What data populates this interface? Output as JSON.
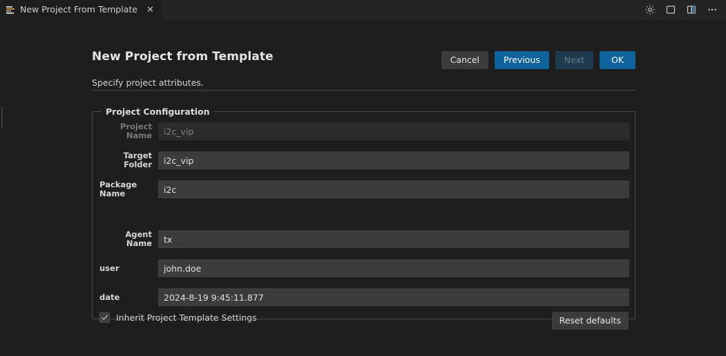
{
  "window": {
    "tab": {
      "icon": "list-lines-icon",
      "label": "New Project From Template",
      "close": "✕"
    },
    "actions": [
      {
        "name": "gear-icon",
        "tooltip": "Settings"
      },
      {
        "name": "single-pane-layout-icon",
        "tooltip": "Single Pane"
      },
      {
        "name": "split-pane-layout-icon",
        "tooltip": "Split Pane"
      },
      {
        "name": "more-options-icon",
        "tooltip": "More"
      }
    ]
  },
  "header": {
    "title": "New Project from Template",
    "subtitle": "Specify project attributes."
  },
  "buttons": {
    "cancel": "Cancel",
    "previous": "Previous",
    "next": "Next",
    "ok": "OK"
  },
  "group": {
    "title": "Project Configuration",
    "fields": [
      {
        "label": "Project Name",
        "value": "i2c_vip",
        "disabled": true,
        "align": "right"
      },
      {
        "label": "Target Folder",
        "value": "i2c_vip",
        "disabled": false,
        "align": "right"
      },
      {
        "label": "Package\nName",
        "value": "i2c",
        "disabled": false,
        "align": "left"
      },
      {
        "label": "Agent Name",
        "value": "tx",
        "disabled": false,
        "align": "right"
      },
      {
        "label": "user",
        "value": "john.doe",
        "disabled": false,
        "align": "left"
      },
      {
        "label": "date",
        "value": "2024-8-19 9:45:11.877",
        "disabled": false,
        "align": "left"
      }
    ],
    "inherit_checkbox": {
      "label": "Inherit Project Template Settings",
      "checked": true
    },
    "reset_button": "Reset defaults"
  },
  "colors": {
    "background": "#1e1e1e",
    "tabbar": "#252526",
    "accent": "#0e639c",
    "field": "#3c3c3c",
    "field_disabled": "#2b2b2b",
    "border": "#4a4a4a"
  }
}
